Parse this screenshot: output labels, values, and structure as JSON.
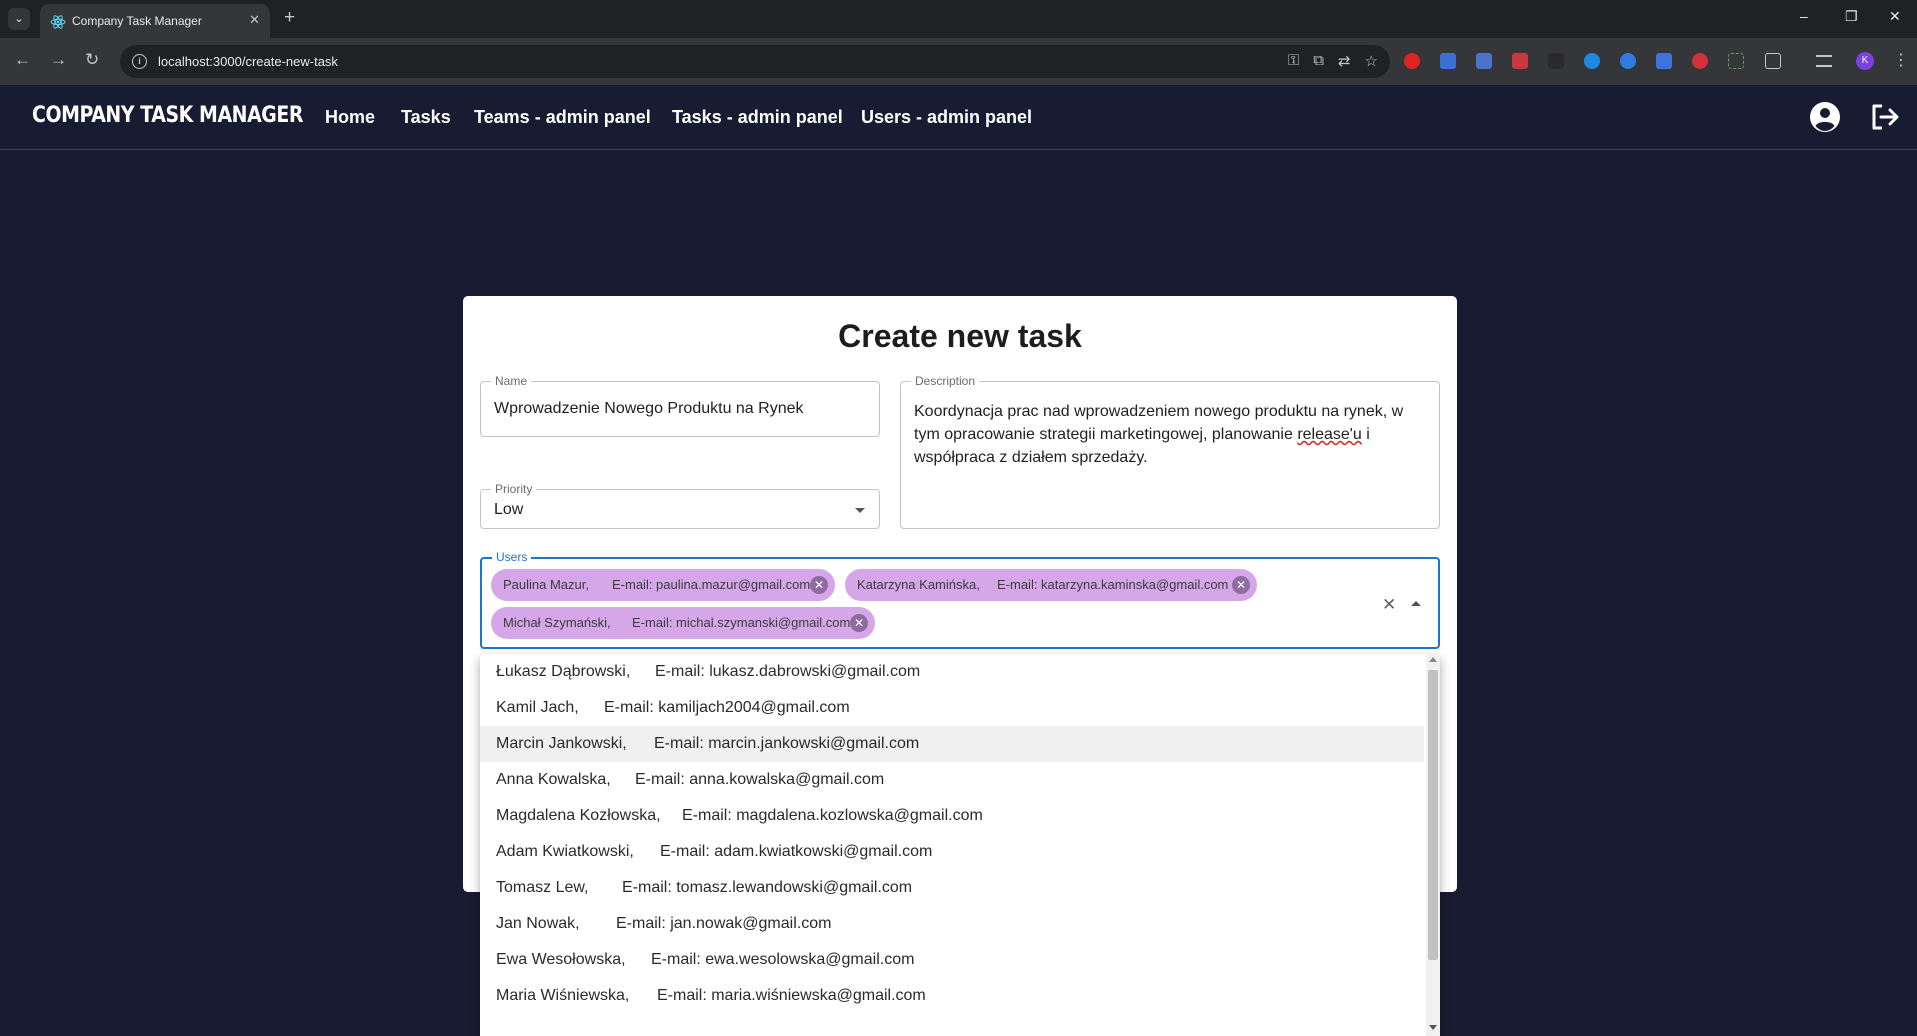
{
  "browser": {
    "tab_title": "Company Task Manager",
    "url": "localhost:3000/create-new-task",
    "profile_initial": "K",
    "new_tab_label": "+",
    "window_controls": [
      "–",
      "❐",
      "✕"
    ]
  },
  "header": {
    "brand": "COMPANY TASK MANAGER",
    "nav": [
      "Home",
      "Tasks",
      "Teams - admin panel",
      "Tasks - admin panel",
      "Users - admin panel"
    ]
  },
  "form": {
    "title": "Create new task",
    "name": {
      "label": "Name",
      "value": "Wprowadzenie Nowego Produktu na Rynek"
    },
    "description": {
      "label": "Description",
      "line1": "Koordynacja prac nad wprowadzeniem nowego produktu na rynek, w",
      "line2_before": "tym opracowanie strategii marketingowej, planowanie ",
      "line2_misspelled": "release'u",
      "line2_after": " i",
      "line3": "współpraca z działem sprzedaży."
    },
    "priority": {
      "label": "Priority",
      "value": "Low"
    },
    "users": {
      "label": "Users",
      "selected": [
        {
          "name": "Paulina Mazur,",
          "email": "E-mail: paulina.mazur@gmail.com"
        },
        {
          "name": "Katarzyna Kamińska,",
          "email": "E-mail: katarzyna.kaminska@gmail.com"
        },
        {
          "name": "Michał Szymański,",
          "email": "E-mail: michal.szymanski@gmail.com"
        }
      ],
      "options": [
        {
          "name": "Łukasz Dąbrowski,",
          "email": "E-mail: lukasz.dabrowski@gmail.com"
        },
        {
          "name": "Kamil Jach,",
          "email": "E-mail: kamiljach2004@gmail.com"
        },
        {
          "name": "Marcin Jankowski,",
          "email": "E-mail: marcin.jankowski@gmail.com"
        },
        {
          "name": "Anna Kowalska,",
          "email": "E-mail: anna.kowalska@gmail.com"
        },
        {
          "name": "Magdalena Kozłowska,",
          "email": "E-mail: magdalena.kozlowska@gmail.com"
        },
        {
          "name": "Adam Kwiatkowski,",
          "email": "E-mail: adam.kwiatkowski@gmail.com"
        },
        {
          "name": "Tomasz Lew,",
          "email": "E-mail: tomasz.lewandowski@gmail.com"
        },
        {
          "name": "Jan Nowak,",
          "email": "E-mail: jan.nowak@gmail.com"
        },
        {
          "name": "Ewa Wesołowska,",
          "email": "E-mail: ewa.wesolowska@gmail.com"
        },
        {
          "name": "Maria Wiśniewska,",
          "email": "E-mail: maria.wiśniewska@gmail.com"
        }
      ],
      "highlighted_index": 2
    }
  },
  "colors": {
    "page_bg": "#181c33",
    "chip_bg": "#d6a7e8",
    "focus_blue": "#1976d2"
  }
}
